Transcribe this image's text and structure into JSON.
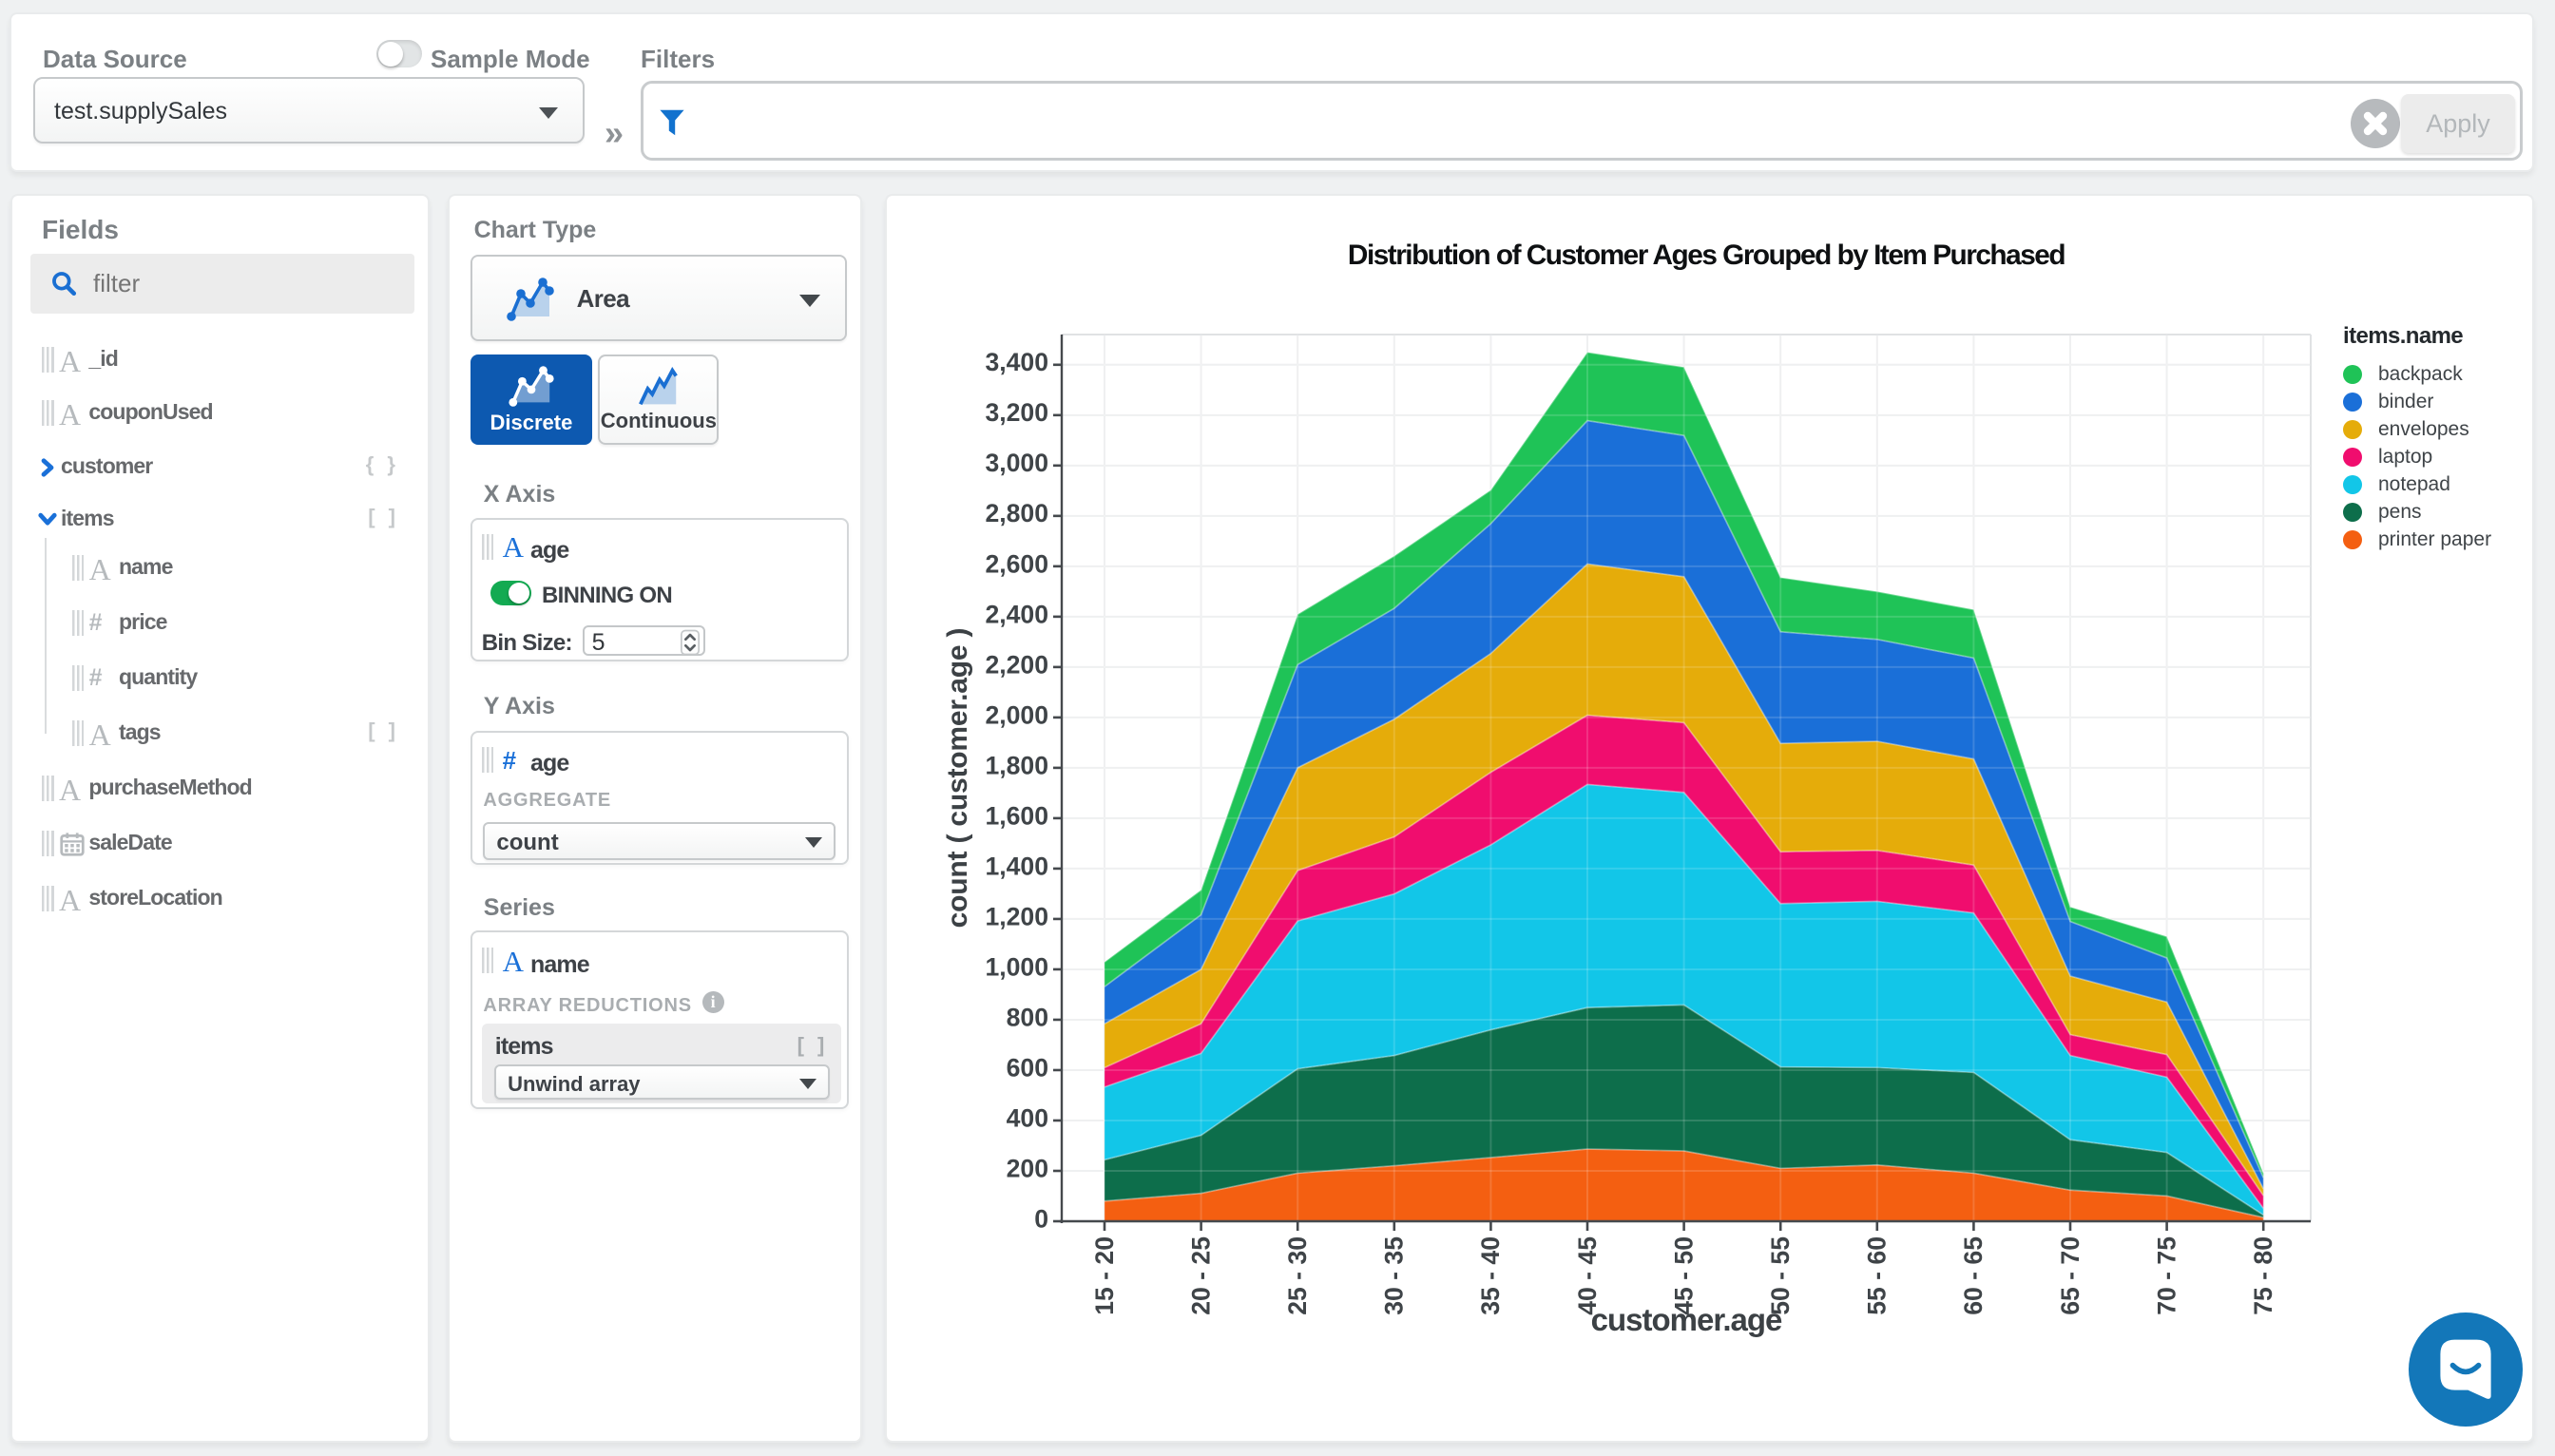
{
  "topbar": {
    "data_source_label": "Data Source",
    "data_source_value": "test.supplySales",
    "sample_mode_label": "Sample Mode",
    "filters_label": "Filters",
    "filter_value": "",
    "apply_label": "Apply",
    "collapse_glyph": "»"
  },
  "fields_panel": {
    "title": "Fields",
    "search_placeholder": "filter",
    "items": [
      {
        "label": "_id",
        "type": "string"
      },
      {
        "label": "couponUsed",
        "type": "string"
      },
      {
        "label": "customer",
        "type": "object",
        "badge": "{ }",
        "state": "collapsed"
      },
      {
        "label": "items",
        "type": "array",
        "badge": "[ ]",
        "state": "expanded"
      },
      {
        "label": "name",
        "type": "string",
        "child": true
      },
      {
        "label": "price",
        "type": "number",
        "child": true
      },
      {
        "label": "quantity",
        "type": "number",
        "child": true
      },
      {
        "label": "tags",
        "type": "string",
        "badge": "[ ]",
        "child": true
      },
      {
        "label": "purchaseMethod",
        "type": "string"
      },
      {
        "label": "saleDate",
        "type": "date"
      },
      {
        "label": "storeLocation",
        "type": "string"
      }
    ]
  },
  "encode_panel": {
    "chart_type_label": "Chart Type",
    "chart_type_value": "Area",
    "discrete_label": "Discrete",
    "continuous_label": "Continuous",
    "selected_mode": "Discrete",
    "x_axis": {
      "heading": "X Axis",
      "field": "age",
      "field_type": "string",
      "binning_label": "BINNING ON",
      "binning_on": true,
      "bin_size_label": "Bin Size:",
      "bin_size_value": "5"
    },
    "y_axis": {
      "heading": "Y Axis",
      "field": "age",
      "field_type": "number",
      "aggregate_label": "AGGREGATE",
      "aggregate_value": "count"
    },
    "series": {
      "heading": "Series",
      "field": "name",
      "field_type": "string",
      "reductions_label": "ARRAY REDUCTIONS",
      "array_field": "items",
      "array_badge": "[ ]",
      "reduction_value": "Unwind array"
    }
  },
  "chart_data": {
    "type": "area",
    "stacked": true,
    "title": "Distribution of Customer Ages Grouped by Item Purchased",
    "xlabel": "customer.age",
    "ylabel": "count ( customer.age )",
    "legend_title": "items.name",
    "legend_position": "right",
    "grid": true,
    "categories": [
      "15 - 20",
      "20 - 25",
      "25 - 30",
      "30 - 35",
      "35 - 40",
      "40 - 45",
      "45 - 50",
      "50 - 55",
      "55 - 60",
      "60 - 65",
      "65 - 70",
      "70 - 75",
      "75 - 80"
    ],
    "ylim": [
      0,
      3520
    ],
    "ytick_interval": 200,
    "series": [
      {
        "name": "backpack",
        "color": "#1fc357",
        "values": [
          98,
          99,
          200,
          208,
          134,
          272,
          272,
          216,
          190,
          192,
          58,
          85,
          18
        ]
      },
      {
        "name": "binder",
        "color": "#1a6fd8",
        "values": [
          147,
          216,
          409,
          440,
          515,
          569,
          560,
          443,
          405,
          401,
          217,
          175,
          44
        ]
      },
      {
        "name": "envelopes",
        "color": "#e5ac0a",
        "values": [
          174,
          216,
          408,
          467,
          472,
          600,
          580,
          430,
          433,
          421,
          232,
          208,
          27
        ]
      },
      {
        "name": "laptop",
        "color": "#f00d6e",
        "values": [
          77,
          118,
          200,
          227,
          288,
          275,
          277,
          206,
          202,
          190,
          83,
          90,
          51
        ]
      },
      {
        "name": "notepad",
        "color": "#12c6e8",
        "values": [
          289,
          325,
          587,
          641,
          734,
          886,
          843,
          648,
          660,
          633,
          334,
          299,
          26
        ]
      },
      {
        "name": "pens",
        "color": "#0d6e4b",
        "values": [
          164,
          230,
          414,
          438,
          507,
          561,
          580,
          403,
          387,
          400,
          200,
          173,
          10
        ]
      },
      {
        "name": "printer paper",
        "color": "#f45f11",
        "values": [
          80,
          111,
          191,
          220,
          253,
          287,
          279,
          210,
          223,
          191,
          124,
          100,
          15
        ]
      }
    ],
    "stack_order_bottom_to_top": [
      "printer paper",
      "pens",
      "notepad",
      "laptop",
      "envelopes",
      "binder",
      "backpack"
    ]
  },
  "intercom": {
    "icon": "intercom-chat-bubble",
    "color": "#1377b9"
  }
}
